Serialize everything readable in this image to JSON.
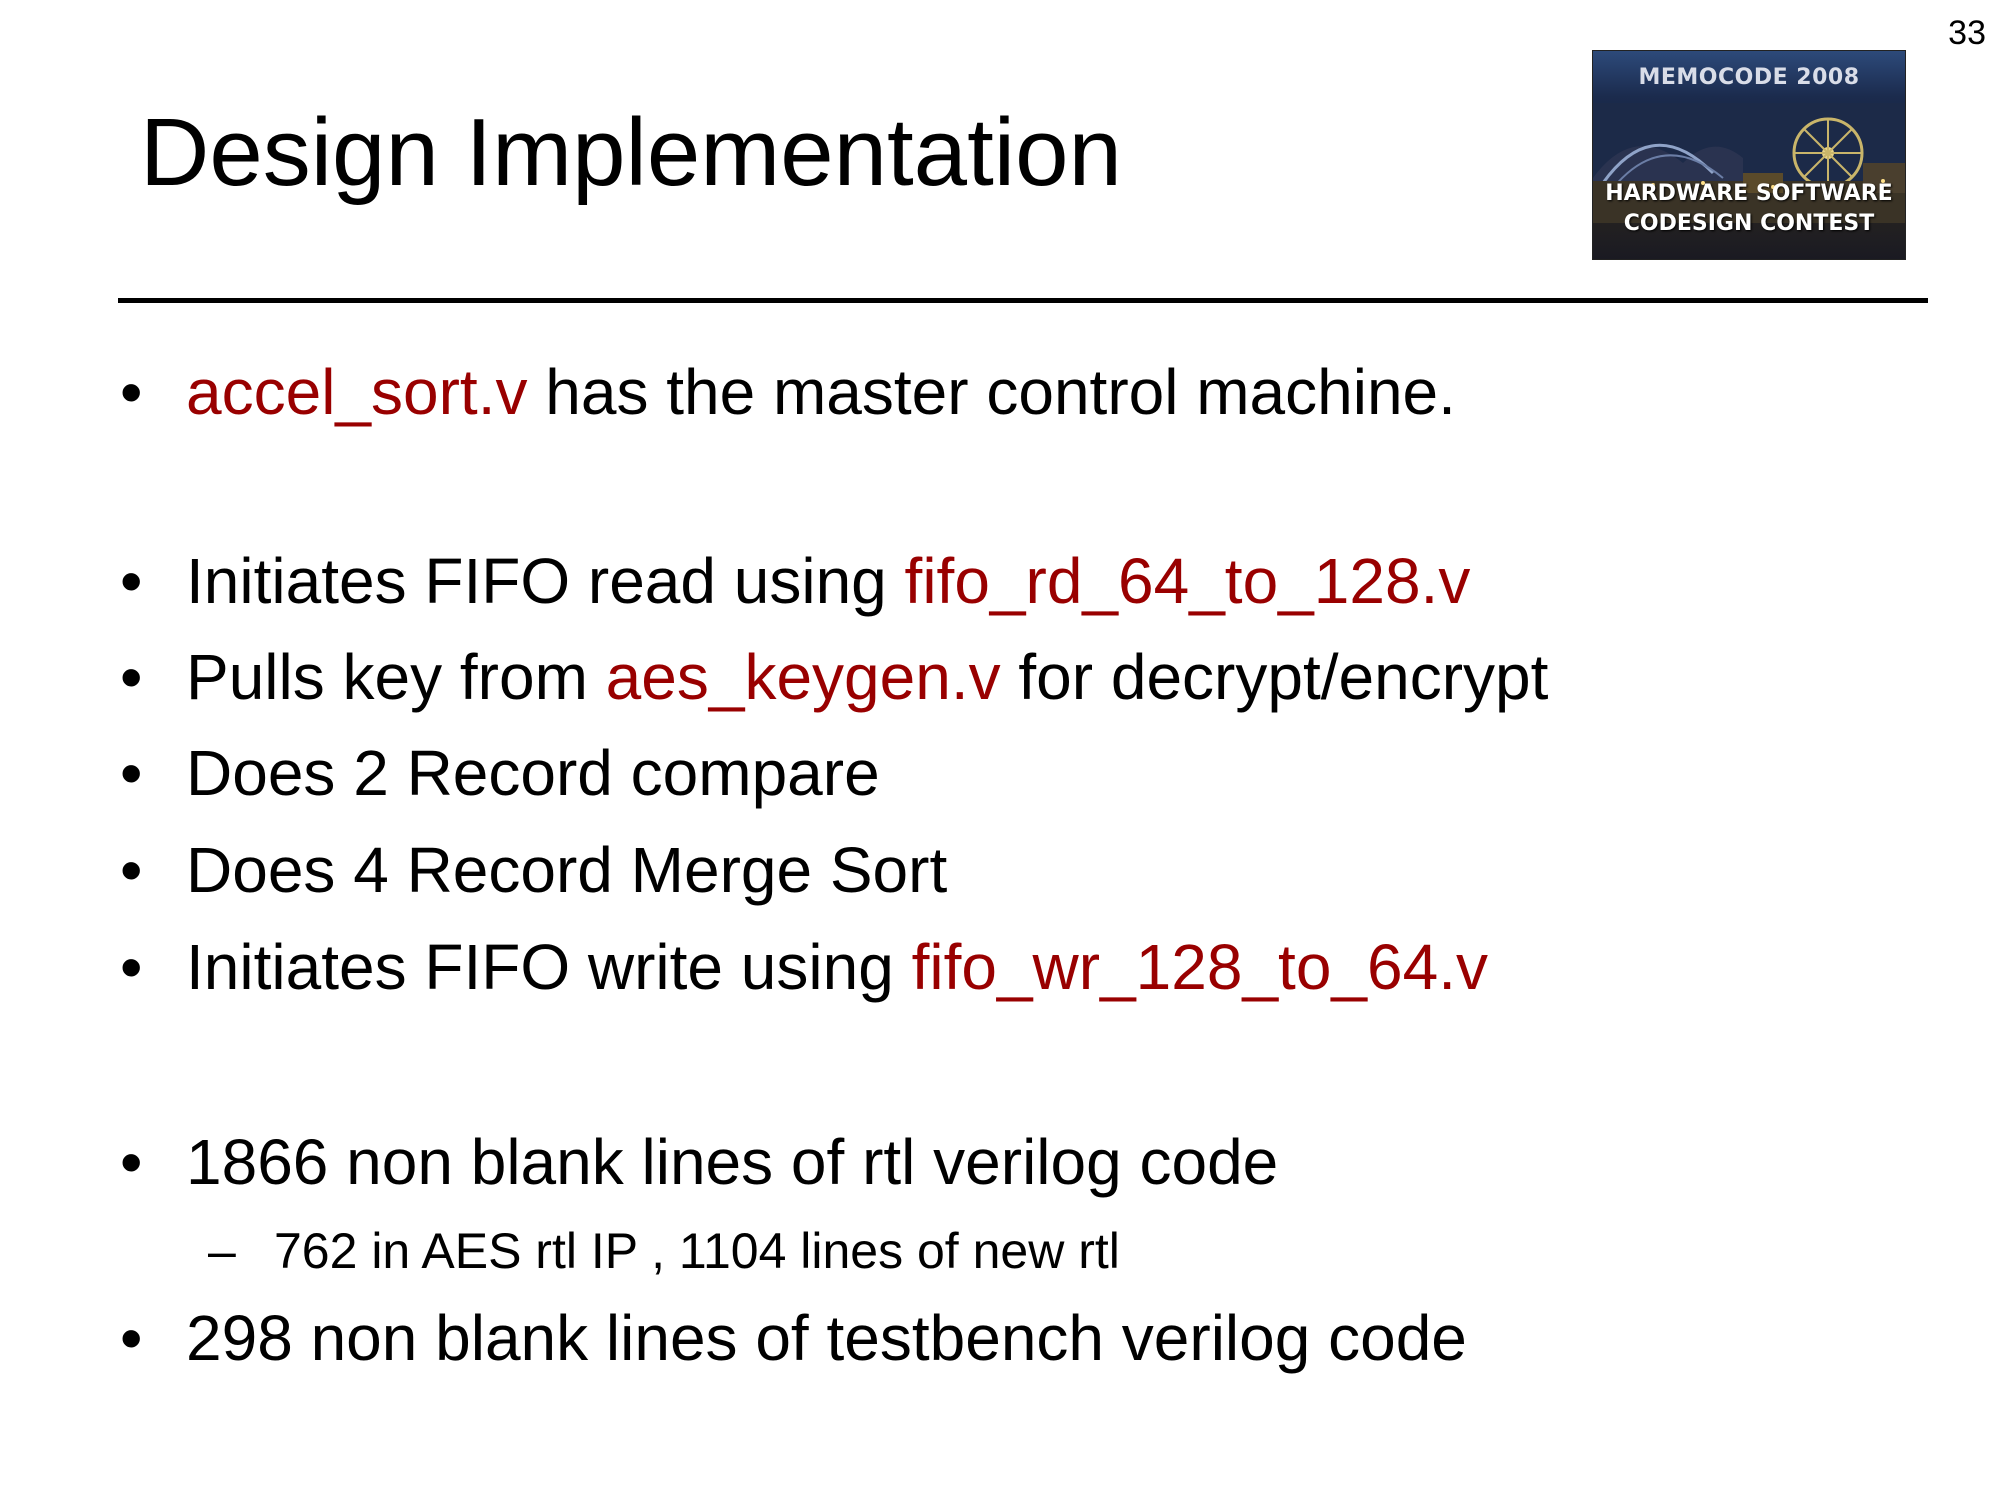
{
  "slide": {
    "number": "33",
    "title": "Design Implementation"
  },
  "logo": {
    "top_text": "MEMOCODE 2008",
    "bottom_line1": "HARDWARE SOFTWARE",
    "bottom_line2": "CODESIGN CONTEST"
  },
  "colors": {
    "highlight": "#990000",
    "text": "#000000"
  },
  "bullets": [
    {
      "bullet": "•",
      "red": "accel_sort.v",
      "rest": " has the master control machine."
    },
    {
      "bullet": "•",
      "pre": "Initiates FIFO read using ",
      "red": "fifo_rd_64_to_128.v"
    },
    {
      "bullet": "•",
      "pre": "Pulls key from ",
      "red": "aes_keygen.v",
      "rest": " for decrypt/encrypt"
    },
    {
      "bullet": "•",
      "text": "Does 2 Record compare"
    },
    {
      "bullet": "•",
      "text": "Does 4 Record Merge Sort"
    },
    {
      "bullet": "•",
      "pre": "Initiates FIFO write using ",
      "red": "fifo_wr_128_to_64.v"
    },
    {
      "bullet": "•",
      "text": "1866 non blank lines of rtl verilog code"
    },
    {
      "bullet": "•",
      "text": "298 non blank lines of testbench verilog code"
    }
  ],
  "sub_bullet": {
    "dash": "–",
    "text": "762 in AES rtl IP , 1104 lines of new rtl"
  }
}
